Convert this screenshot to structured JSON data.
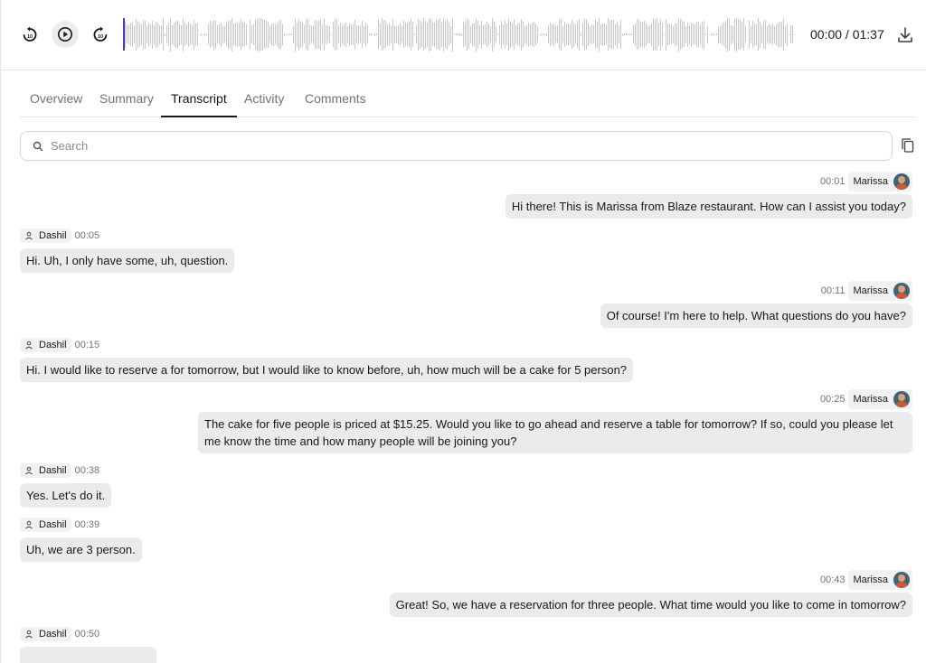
{
  "player": {
    "rewind_label": "10",
    "forward_label": "10",
    "time": "00:00 / 01:37"
  },
  "tabs": [
    {
      "label": "Overview"
    },
    {
      "label": "Summary"
    },
    {
      "label": "Transcript"
    },
    {
      "label": "Activity"
    },
    {
      "label": "Comments"
    }
  ],
  "active_tab": "Transcript",
  "search": {
    "placeholder": "Search",
    "value": ""
  },
  "messages": [
    {
      "speaker": "Marissa",
      "time": "00:01",
      "side": "right",
      "text": "Hi there! This is Marissa from Blaze restaurant. How can I assist you today?"
    },
    {
      "speaker": "Dashil",
      "time": "00:05",
      "side": "left",
      "text": "Hi. Uh, I only have some, uh, question."
    },
    {
      "speaker": "Marissa",
      "time": "00:11",
      "side": "right",
      "text": "Of course! I'm here to help. What questions do you have?"
    },
    {
      "speaker": "Dashil",
      "time": "00:15",
      "side": "left",
      "text": "Hi. I would like to reserve a for tomorrow, but I would like to know before, uh, how much will be a cake for 5 person?"
    },
    {
      "speaker": "Marissa",
      "time": "00:25",
      "side": "right",
      "text": "The cake for five people is priced at $15.25. Would you like to go ahead and reserve a table for tomorrow? If so, could you please let me know the time and how many people will be joining you?"
    },
    {
      "speaker": "Dashil",
      "time": "00:38",
      "side": "left",
      "text": "Yes. Let's do it."
    },
    {
      "speaker": "Dashil",
      "time": "00:39",
      "side": "left",
      "text": "Uh, we are 3 person."
    },
    {
      "speaker": "Marissa",
      "time": "00:43",
      "side": "right",
      "text": "Great! So, we have a reservation for three people. What time would you like to come in tomorrow?"
    },
    {
      "speaker": "Dashil",
      "time": "00:50",
      "side": "left",
      "text": ""
    }
  ],
  "colors": {
    "accent": "#3f3fc8",
    "bubble": "#ebebed",
    "border": "#e4e4e7",
    "muted_text": "#71717a"
  }
}
